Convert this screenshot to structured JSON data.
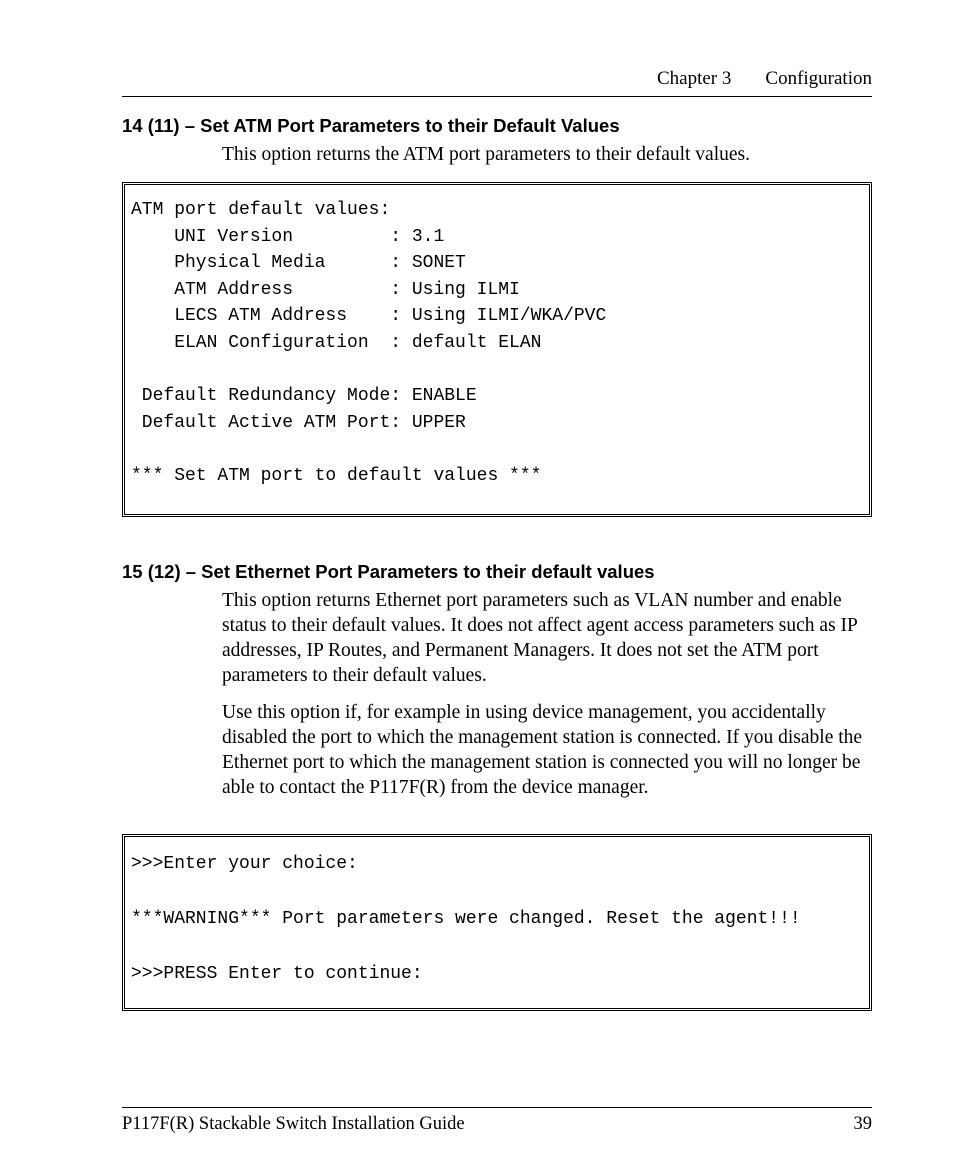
{
  "header": {
    "chapter": "Chapter 3",
    "title": "Configuration"
  },
  "section1": {
    "heading": "14 (11) – Set ATM Port Parameters to their Default Values",
    "body": "This option returns the ATM port parameters to their default values.",
    "code": "ATM port default values:\n    UNI Version         : 3.1\n    Physical Media      : SONET\n    ATM Address         : Using ILMI\n    LECS ATM Address    : Using ILMI/WKA/PVC\n    ELAN Configuration  : default ELAN\n\n Default Redundancy Mode: ENABLE\n Default Active ATM Port: UPPER\n\n*** Set ATM port to default values ***"
  },
  "section2": {
    "heading": "15 (12) – Set Ethernet Port Parameters to their default values",
    "body1": "This option returns Ethernet port parameters such as VLAN number and enable status to their default values. It does not affect agent access parameters such as IP addresses, IP Routes, and Permanent Managers. It does not set the ATM port parameters to their default values.",
    "body2": "Use this option if, for example in using device management, you accidentally disabled the port to which the management station is connected. If you disable the Ethernet port to which the management station is connected you will no longer be able to contact the P117F(R) from the device manager.",
    "code": ">>>Enter your choice:\n\n***WARNING*** Port parameters were changed. Reset the agent!!!\n\n>>>PRESS Enter to continue:"
  },
  "footer": {
    "guide": "P117F(R) Stackable Switch Installation Guide",
    "page": "39"
  }
}
